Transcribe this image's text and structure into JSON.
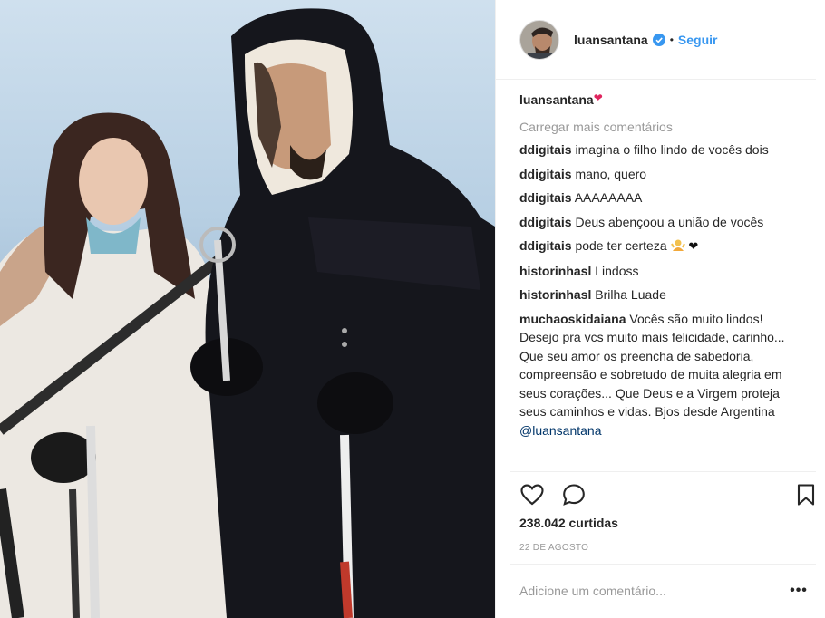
{
  "post_photo": {
    "alt": ""
  },
  "header": {
    "username": "luansantana",
    "separator": "•",
    "follow_label": "Seguir"
  },
  "caption": {
    "username": "luansantana",
    "emoji": "❤"
  },
  "load_more_label": "Carregar mais comentários",
  "comments": [
    {
      "user": "ddigitais",
      "text": "imagina o filho lindo de vocês dois"
    },
    {
      "user": "ddigitais",
      "text": "mano, quero"
    },
    {
      "user": "ddigitais",
      "text": "AAAAAAAA"
    },
    {
      "user": "ddigitais",
      "text": "Deus abençoou a união de vocês"
    },
    {
      "user": "ddigitais",
      "text": "pode ter certeza",
      "emoji": "❤"
    },
    {
      "user": "historinhasl",
      "text": "Lindoss"
    },
    {
      "user": "historinhasl",
      "text": "Brilha Luade"
    },
    {
      "user": "muchaoskidaiana",
      "text": "Vocês são muito lindos! Desejo pra vcs muito mais felicidade, carinho... Que seu amor os preencha de sabedoria, compreensão e sobretudo de muita alegria em seus corações... Que Deus e a Virgem proteja seus caminhos e vidas. Bjos desde Argentina",
      "mention": "@luansantana"
    }
  ],
  "actions": {
    "like_icon": "heart-outline-icon",
    "comment_icon": "speech-bubble-icon",
    "save_icon": "bookmark-icon"
  },
  "likes": "238.042 curtidas",
  "date": "22 DE AGOSTO",
  "add_comment_placeholder": "Adicione um comentário...",
  "more_label": "•••",
  "colors": {
    "link": "#3897f0",
    "text": "#262626",
    "muted": "#999999",
    "verified": "#3897f0",
    "heart": "#e0245e"
  }
}
